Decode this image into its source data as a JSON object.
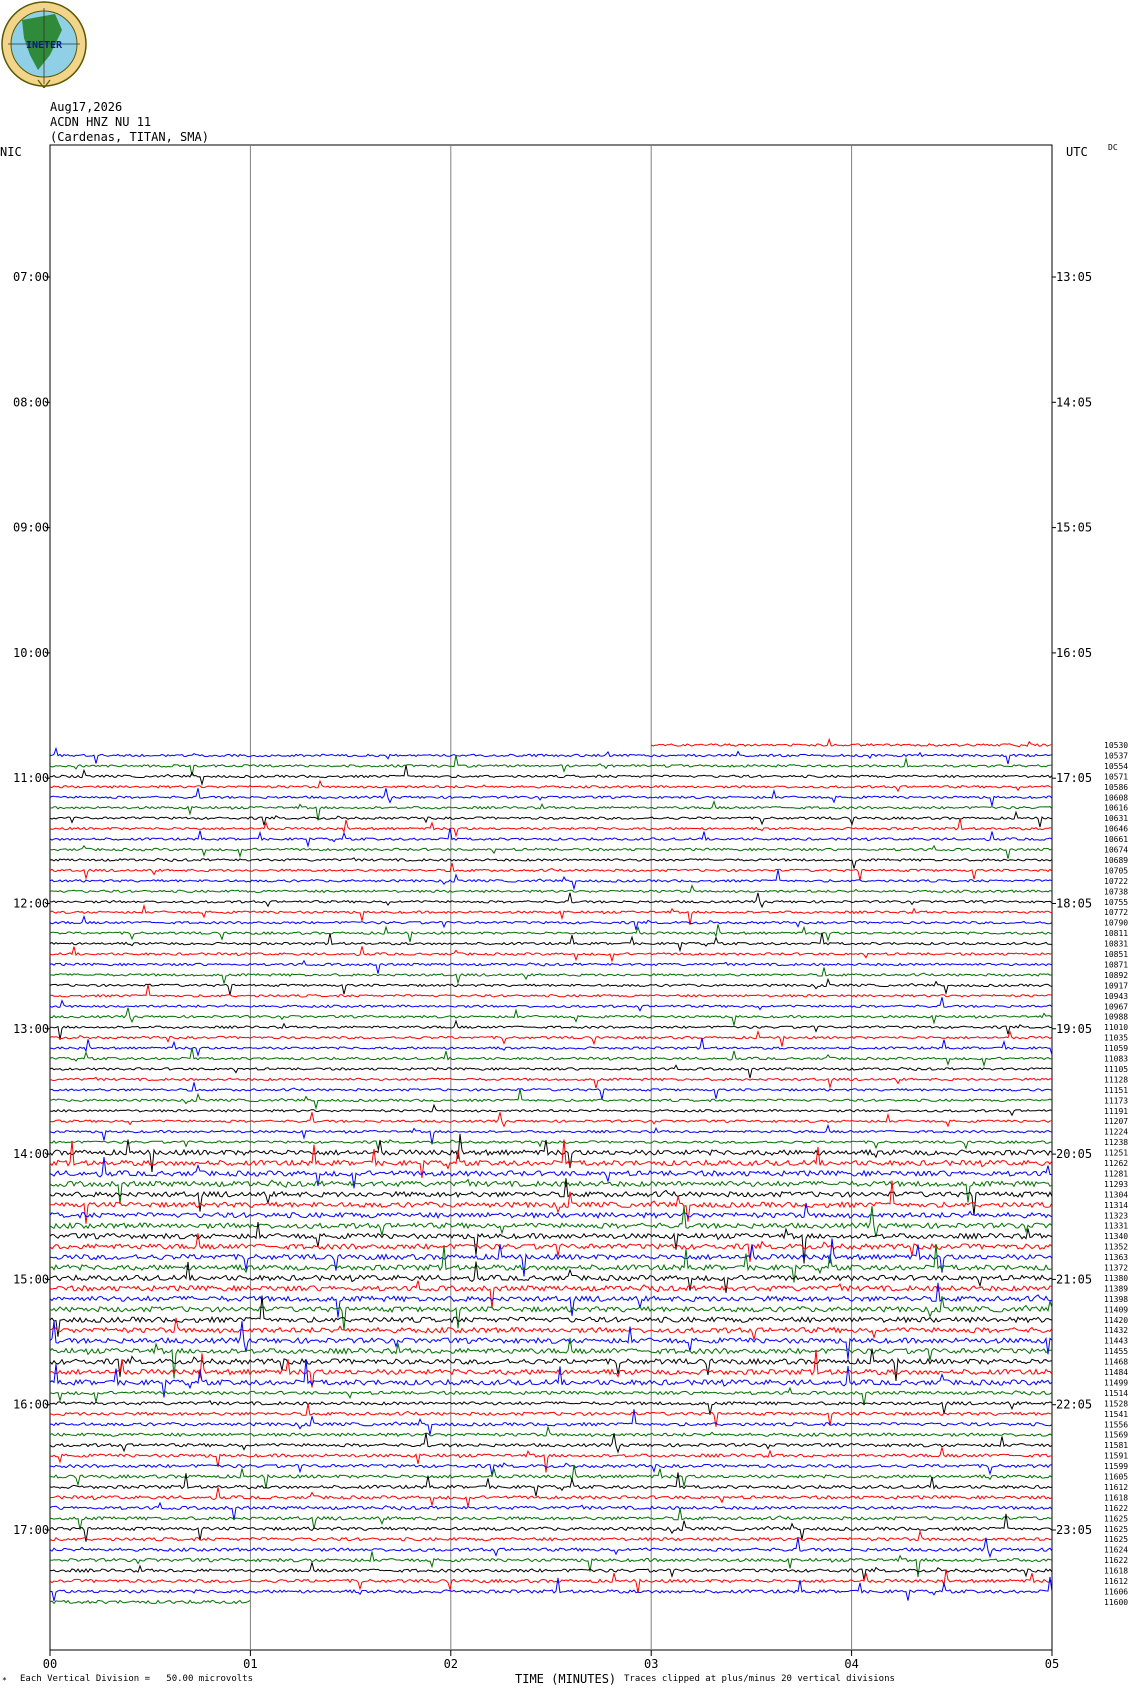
{
  "header": {
    "logo_text": "INETER",
    "date": "Aug17,2026",
    "station": "ACDN HNZ NU 11",
    "location": "(Cardenas, TITAN, SMA)",
    "left_tz": "NIC",
    "right_tz": "UTC",
    "dc_label": "DC"
  },
  "footer": {
    "scale_text": "Each Vertical Division =   50.00 microvolts",
    "axis_title": "TIME (MINUTES)",
    "clip_text": "Traces clipped at plus/minus 20 vertical divisions"
  },
  "colors": {
    "trace_cycle": [
      "#ff0000",
      "#0000ff",
      "#007000",
      "#000000"
    ],
    "grid": "#808080"
  },
  "chart_data": {
    "type": "line",
    "title": "",
    "xlabel": "TIME (MINUTES)",
    "xlim": [
      0,
      5
    ],
    "x_ticks": [
      "00",
      "01",
      "02",
      "03",
      "04",
      "05"
    ],
    "left_hour_labels": [
      "07:00",
      "08:00",
      "09:00",
      "10:00",
      "11:00",
      "12:00",
      "13:00",
      "14:00",
      "15:00",
      "16:00",
      "17:00"
    ],
    "right_hour_labels": [
      "13:05",
      "14:05",
      "15:05",
      "16:05",
      "17:05",
      "18:05",
      "19:05",
      "20:05",
      "21:05",
      "22:05",
      "23:05"
    ],
    "first_trace_start_minute": 3.0,
    "last_trace_end_minute": 1.0,
    "trace_colors_order": "red, blue, green, black repeating (first trace red)",
    "right_values": [
      "10530",
      "10537",
      "10554",
      "10571",
      "10586",
      "10608",
      "10616",
      "10631",
      "10646",
      "10661",
      "10674",
      "10689",
      "10705",
      "10722",
      "10738",
      "10755",
      "10772",
      "10790",
      "10811",
      "10831",
      "10851",
      "10871",
      "10892",
      "10917",
      "10943",
      "10967",
      "10988",
      "11010",
      "11035",
      "11059",
      "11083",
      "11105",
      "11128",
      "11151",
      "11173",
      "11191",
      "11207",
      "11224",
      "11238",
      "11251",
      "11262",
      "11281",
      "11293",
      "11304",
      "11314",
      "11323",
      "11331",
      "11340",
      "11352",
      "11363",
      "11372",
      "11380",
      "11389",
      "11398",
      "11409",
      "11420",
      "11432",
      "11443",
      "11455",
      "11468",
      "11484",
      "11499",
      "11514",
      "11528",
      "11541",
      "11556",
      "11569",
      "11581",
      "11591",
      "11599",
      "11605",
      "11612",
      "11618",
      "11622",
      "11625",
      "11625",
      "11625",
      "11624",
      "11622",
      "11618",
      "11612",
      "11606",
      "11600"
    ]
  }
}
